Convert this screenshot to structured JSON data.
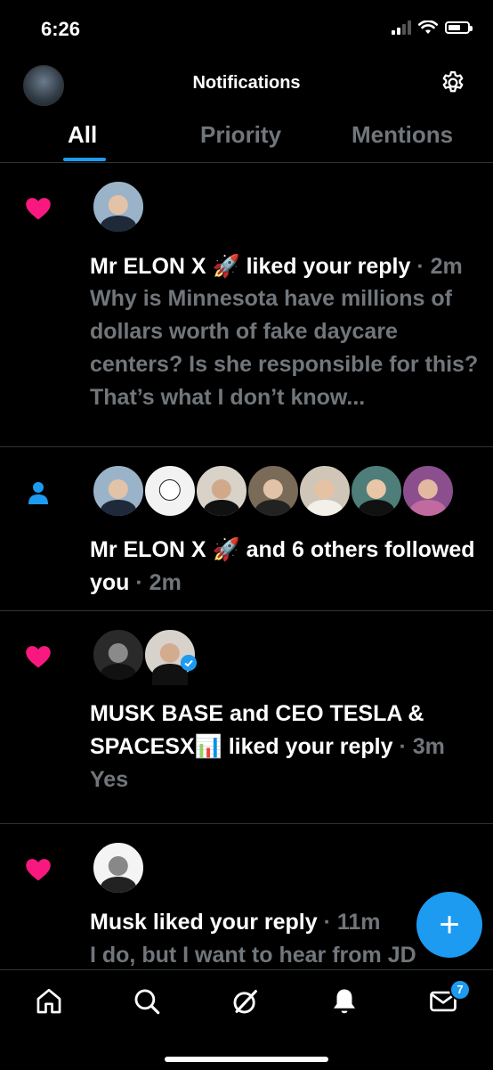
{
  "status_bar": {
    "time": "6:26",
    "icons": [
      "signal-icon",
      "wifi-icon",
      "battery-icon"
    ]
  },
  "header": {
    "title": "Notifications",
    "avatar": "profile-avatar",
    "settings_icon": "gear-icon"
  },
  "tabs": [
    {
      "label": "All",
      "active": true
    },
    {
      "label": "Priority",
      "active": false
    },
    {
      "label": "Mentions",
      "active": false
    }
  ],
  "notifications": [
    {
      "type": "like",
      "icon": "heart-icon",
      "actor": "Mr ELON X 🚀",
      "action": "liked your reply",
      "time": "2m",
      "snippet": "Why is Minnesota have millions of dollars worth of fake daycare centers? Is she responsible for this? That’s what I don’t know..."
    },
    {
      "type": "follow",
      "icon": "person-icon",
      "actor": "Mr ELON X 🚀",
      "action": "and 6 others followed you",
      "time": "2m"
    },
    {
      "type": "like",
      "icon": "heart-icon",
      "actor": "MUSK BASE and CEO TESLA & SPACESX📊",
      "action": "liked your reply",
      "time": "3m",
      "snippet": "Yes"
    },
    {
      "type": "like",
      "icon": "heart-icon",
      "actor": "Musk",
      "action": "liked your reply",
      "time": "11m",
      "snippet": "I do, but I want to hear from JD"
    }
  ],
  "fab": {
    "label": "+"
  },
  "bottom_nav": {
    "items": [
      "home-icon",
      "search-icon",
      "grok-icon",
      "bell-icon",
      "mail-icon"
    ],
    "messages_badge": "7"
  },
  "colors": {
    "accent": "#1d9bf0",
    "like": "#f91880",
    "muted": "#71767b"
  }
}
